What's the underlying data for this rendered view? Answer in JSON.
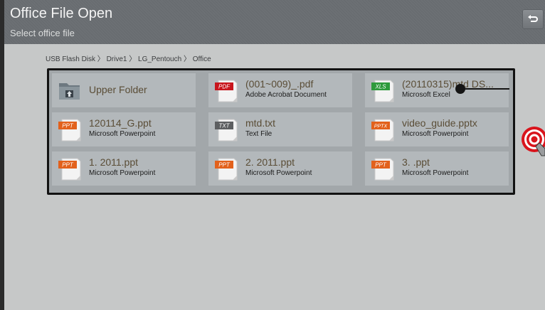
{
  "header": {
    "title": "Office File Open",
    "subtitle": "Select office file"
  },
  "breadcrumb": {
    "text": "USB Flash Disk 〉 Drive1 〉 LG_Pentouch 〉 Office"
  },
  "files": [
    {
      "name": "Upper Folder",
      "type": "",
      "icon": "upper-folder-icon",
      "badge": ""
    },
    {
      "name": "(001~009)_.pdf",
      "type": "Adobe Acrobat Document",
      "icon": "pdf-file-icon",
      "badge": "PDF"
    },
    {
      "name": "(20110315)mtd DS...",
      "type": "Microsoft Excel",
      "icon": "xls-file-icon",
      "badge": "XLS"
    },
    {
      "name": "120114_G.ppt",
      "type": "Microsoft Powerpoint",
      "icon": "ppt-file-icon",
      "badge": "PPT"
    },
    {
      "name": "mtd.txt",
      "type": "Text File",
      "icon": "txt-file-icon",
      "badge": "TXT"
    },
    {
      "name": "video_guide.pptx",
      "type": "Microsoft Powerpoint",
      "icon": "pptx-file-icon",
      "badge": "PPTX"
    },
    {
      "name": "1. 2011.ppt",
      "type": "Microsoft Powerpoint",
      "icon": "ppt-file-icon",
      "badge": "PPT"
    },
    {
      "name": "2. 2011.ppt",
      "type": "Microsoft Powerpoint",
      "icon": "ppt-file-icon",
      "badge": "PPT"
    },
    {
      "name": "3. .ppt",
      "type": "Microsoft Powerpoint",
      "icon": "ppt-file-icon",
      "badge": "PPT"
    }
  ],
  "colors": {
    "pdf": "#c8161d",
    "xls": "#2e9a3c",
    "ppt": "#e2611c",
    "txt": "#5d5f61",
    "target": "#d9141c"
  }
}
